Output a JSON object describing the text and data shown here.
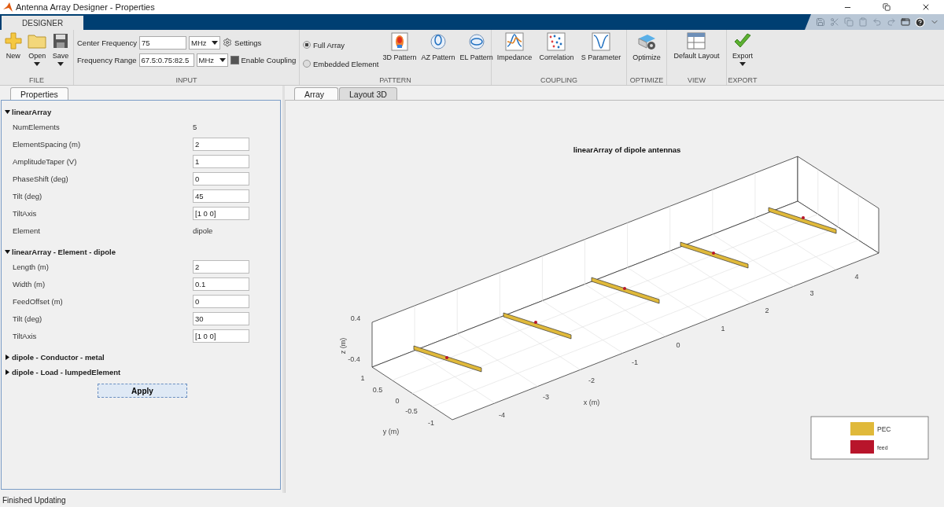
{
  "window": {
    "title": "Antenna Array Designer - Properties"
  },
  "ribbon_tabs": [
    {
      "label": "DESIGNER",
      "selected": true
    }
  ],
  "ribbon": {
    "file": {
      "label": "FILE",
      "buttons": [
        {
          "label": "New",
          "menu": false
        },
        {
          "label": "Open",
          "menu": true
        },
        {
          "label": "Save",
          "menu": true
        }
      ]
    },
    "input": {
      "label": "INPUT",
      "center_frequency": {
        "label": "Center Frequency",
        "value": "75",
        "unit": "MHz"
      },
      "frequency_range": {
        "label": "Frequency Range",
        "value": "67.5:0.75:82.5",
        "unit": "MHz"
      },
      "settings": "Settings",
      "enable_coupling": {
        "label": "Enable Coupling",
        "checked": true
      }
    },
    "pattern": {
      "label": "PATTERN",
      "radios": [
        {
          "label": "Full Array",
          "selected": true
        },
        {
          "label": "Embedded Element",
          "selected": false
        }
      ],
      "buttons": [
        {
          "label": "3D Pattern"
        },
        {
          "label": "AZ Pattern"
        },
        {
          "label": "EL Pattern"
        }
      ]
    },
    "coupling": {
      "label": "COUPLING",
      "buttons": [
        {
          "label": "Impedance"
        },
        {
          "label": "Correlation"
        },
        {
          "label": "S Parameter"
        }
      ]
    },
    "optimize": {
      "label": "OPTIMIZE",
      "buttons": [
        {
          "label": "Optimize"
        }
      ]
    },
    "view": {
      "label": "VIEW",
      "buttons": [
        {
          "label": "Default Layout"
        }
      ]
    },
    "export": {
      "label": "EXPORT",
      "buttons": [
        {
          "label": "Export",
          "menu": true
        }
      ]
    }
  },
  "properties": {
    "tab": "Properties",
    "sections": [
      {
        "title": "linearArray",
        "expanded": true,
        "items": [
          {
            "label": "NumElements",
            "kind": "text",
            "value": "5"
          },
          {
            "label": "ElementSpacing (m)",
            "kind": "field",
            "value": "2"
          },
          {
            "label": "AmplitudeTaper (V)",
            "kind": "field",
            "value": "1"
          },
          {
            "label": "PhaseShift (deg)",
            "kind": "field",
            "value": "0"
          },
          {
            "label": "Tilt (deg)",
            "kind": "field",
            "value": "45"
          },
          {
            "label": "TiltAxis",
            "kind": "field",
            "value": "[1 0 0]"
          },
          {
            "label": "Element",
            "kind": "text",
            "value": "dipole"
          }
        ]
      },
      {
        "title": "linearArray - Element - dipole",
        "expanded": true,
        "items": [
          {
            "label": "Length (m)",
            "kind": "field",
            "value": "2"
          },
          {
            "label": "Width (m)",
            "kind": "field",
            "value": "0.1"
          },
          {
            "label": "FeedOffset (m)",
            "kind": "field",
            "value": "0"
          },
          {
            "label": "Tilt (deg)",
            "kind": "field",
            "value": "30"
          },
          {
            "label": "TiltAxis",
            "kind": "field",
            "value": "[1 0 0]"
          }
        ]
      },
      {
        "title": "dipole - Conductor - metal",
        "expanded": false
      },
      {
        "title": "dipole - Load - lumpedElement",
        "expanded": false
      }
    ],
    "apply": "Apply"
  },
  "document_tabs": [
    {
      "label": "Array",
      "selected": true
    },
    {
      "label": "Layout 3D",
      "selected": false
    }
  ],
  "plot": {
    "title": "linearArray of dipole antennas",
    "xlabel": "x (m)",
    "ylabel": "y (m)",
    "zlabel": "z (m)",
    "xticks": [
      "-4",
      "-3",
      "-2",
      "-1",
      "0",
      "1",
      "2",
      "3",
      "4"
    ],
    "yticks": [
      "1",
      "0.5",
      "0",
      "-0.5",
      "-1"
    ],
    "zticks": [
      "0.4",
      "-0.4"
    ],
    "legend": [
      {
        "label": "PEC",
        "color": "#e0b93a"
      },
      {
        "label": "feed",
        "color": "#b8152b"
      }
    ]
  },
  "status_bar": "Finished Updating"
}
